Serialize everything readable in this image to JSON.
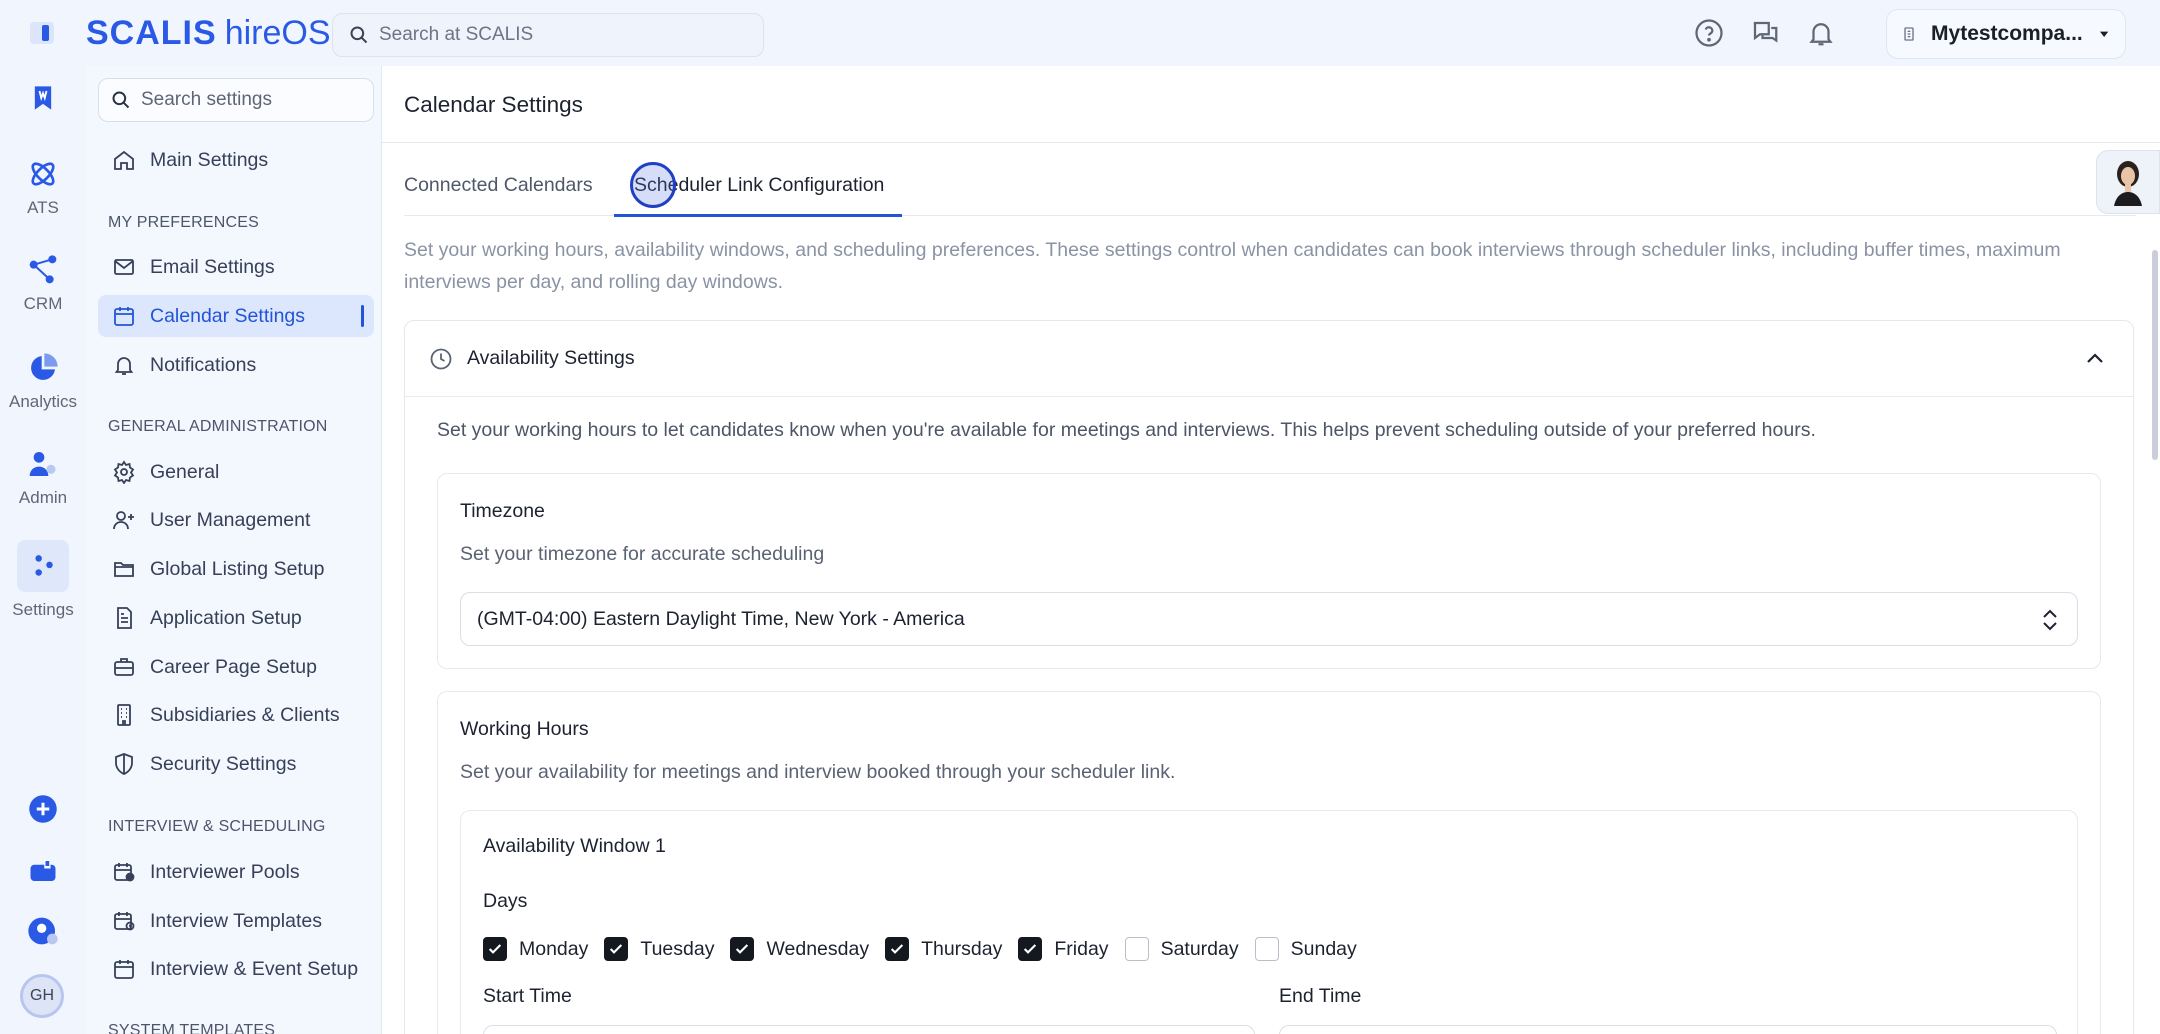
{
  "brand": {
    "name": "SCALIS",
    "product": "hireOS"
  },
  "top_search": {
    "placeholder": "Search at SCALIS"
  },
  "company": {
    "name": "Mytestcompa..."
  },
  "rail": {
    "items": [
      {
        "label": "",
        "icon": "bookmark-icon"
      },
      {
        "label": "ATS",
        "icon": "atom-icon"
      },
      {
        "label": "CRM",
        "icon": "network-icon"
      },
      {
        "label": "Analytics",
        "icon": "pie-chart-icon"
      },
      {
        "label": "Admin",
        "icon": "admin-user-icon"
      },
      {
        "label": "Settings",
        "icon": "settings-nodes-icon"
      }
    ],
    "avatar_initials": "GH"
  },
  "sidebar": {
    "search_placeholder": "Search settings",
    "main_settings": "Main Settings",
    "sections": {
      "my_preferences": "MY PREFERENCES",
      "general_admin": "GENERAL ADMINISTRATION",
      "interview_scheduling": "INTERVIEW & SCHEDULING",
      "system_templates": "SYSTEM TEMPLATES"
    },
    "items": {
      "email": "Email Settings",
      "calendar": "Calendar Settings",
      "notifications": "Notifications",
      "general": "General",
      "user_management": "User Management",
      "global_listing": "Global Listing Setup",
      "application": "Application Setup",
      "career_page": "Career Page Setup",
      "subsidiaries": "Subsidiaries & Clients",
      "security": "Security Settings",
      "interviewer_pools": "Interviewer Pools",
      "interview_templates": "Interview Templates",
      "interview_event": "Interview & Event Setup"
    }
  },
  "main": {
    "title": "Calendar Settings",
    "tabs": [
      "Connected Calendars",
      "Scheduler Link Configuration"
    ],
    "intro": "Set your working hours, availability windows, and scheduling preferences. These settings control when candidates can book interviews through scheduler links, including buffer times, maximum interviews per day, and rolling day windows.",
    "availability": {
      "title": "Availability Settings",
      "description": "Set your working hours to let candidates know when you're available for meetings and interviews. This helps prevent scheduling outside of your preferred hours.",
      "timezone": {
        "title": "Timezone",
        "subtitle": "Set your timezone for accurate scheduling",
        "value": "(GMT-04:00) Eastern Daylight Time, New York - America"
      },
      "working_hours": {
        "title": "Working Hours",
        "subtitle": "Set your availability for meetings and interview booked through your scheduler link.",
        "window": {
          "title": "Availability Window 1",
          "days_label": "Days",
          "days": [
            {
              "label": "Monday",
              "checked": true
            },
            {
              "label": "Tuesday",
              "checked": true
            },
            {
              "label": "Wednesday",
              "checked": true
            },
            {
              "label": "Thursday",
              "checked": true
            },
            {
              "label": "Friday",
              "checked": true
            },
            {
              "label": "Saturday",
              "checked": false
            },
            {
              "label": "Sunday",
              "checked": false
            }
          ],
          "start_time_label": "Start Time",
          "end_time_label": "End Time"
        }
      }
    }
  },
  "colors": {
    "accent": "#2354d8",
    "brand": "#2a59e6"
  }
}
